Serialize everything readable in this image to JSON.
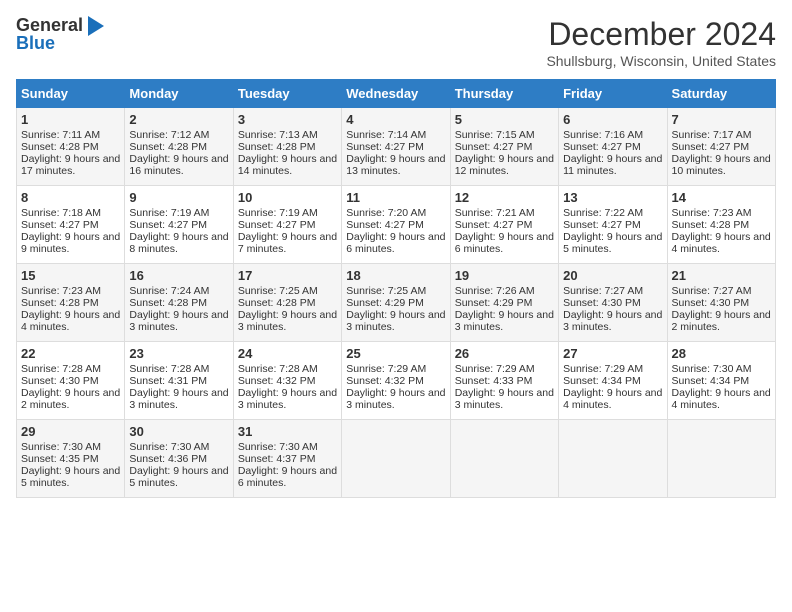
{
  "header": {
    "logo_line1": "General",
    "logo_line2": "Blue",
    "month": "December 2024",
    "location": "Shullsburg, Wisconsin, United States"
  },
  "days_of_week": [
    "Sunday",
    "Monday",
    "Tuesday",
    "Wednesday",
    "Thursday",
    "Friday",
    "Saturday"
  ],
  "weeks": [
    [
      {
        "day": "1",
        "sunrise": "7:11 AM",
        "sunset": "4:28 PM",
        "daylight": "9 hours and 17 minutes."
      },
      {
        "day": "2",
        "sunrise": "7:12 AM",
        "sunset": "4:28 PM",
        "daylight": "9 hours and 16 minutes."
      },
      {
        "day": "3",
        "sunrise": "7:13 AM",
        "sunset": "4:28 PM",
        "daylight": "9 hours and 14 minutes."
      },
      {
        "day": "4",
        "sunrise": "7:14 AM",
        "sunset": "4:27 PM",
        "daylight": "9 hours and 13 minutes."
      },
      {
        "day": "5",
        "sunrise": "7:15 AM",
        "sunset": "4:27 PM",
        "daylight": "9 hours and 12 minutes."
      },
      {
        "day": "6",
        "sunrise": "7:16 AM",
        "sunset": "4:27 PM",
        "daylight": "9 hours and 11 minutes."
      },
      {
        "day": "7",
        "sunrise": "7:17 AM",
        "sunset": "4:27 PM",
        "daylight": "9 hours and 10 minutes."
      }
    ],
    [
      {
        "day": "8",
        "sunrise": "7:18 AM",
        "sunset": "4:27 PM",
        "daylight": "9 hours and 9 minutes."
      },
      {
        "day": "9",
        "sunrise": "7:19 AM",
        "sunset": "4:27 PM",
        "daylight": "9 hours and 8 minutes."
      },
      {
        "day": "10",
        "sunrise": "7:19 AM",
        "sunset": "4:27 PM",
        "daylight": "9 hours and 7 minutes."
      },
      {
        "day": "11",
        "sunrise": "7:20 AM",
        "sunset": "4:27 PM",
        "daylight": "9 hours and 6 minutes."
      },
      {
        "day": "12",
        "sunrise": "7:21 AM",
        "sunset": "4:27 PM",
        "daylight": "9 hours and 6 minutes."
      },
      {
        "day": "13",
        "sunrise": "7:22 AM",
        "sunset": "4:27 PM",
        "daylight": "9 hours and 5 minutes."
      },
      {
        "day": "14",
        "sunrise": "7:23 AM",
        "sunset": "4:28 PM",
        "daylight": "9 hours and 4 minutes."
      }
    ],
    [
      {
        "day": "15",
        "sunrise": "7:23 AM",
        "sunset": "4:28 PM",
        "daylight": "9 hours and 4 minutes."
      },
      {
        "day": "16",
        "sunrise": "7:24 AM",
        "sunset": "4:28 PM",
        "daylight": "9 hours and 3 minutes."
      },
      {
        "day": "17",
        "sunrise": "7:25 AM",
        "sunset": "4:28 PM",
        "daylight": "9 hours and 3 minutes."
      },
      {
        "day": "18",
        "sunrise": "7:25 AM",
        "sunset": "4:29 PM",
        "daylight": "9 hours and 3 minutes."
      },
      {
        "day": "19",
        "sunrise": "7:26 AM",
        "sunset": "4:29 PM",
        "daylight": "9 hours and 3 minutes."
      },
      {
        "day": "20",
        "sunrise": "7:27 AM",
        "sunset": "4:30 PM",
        "daylight": "9 hours and 3 minutes."
      },
      {
        "day": "21",
        "sunrise": "7:27 AM",
        "sunset": "4:30 PM",
        "daylight": "9 hours and 2 minutes."
      }
    ],
    [
      {
        "day": "22",
        "sunrise": "7:28 AM",
        "sunset": "4:30 PM",
        "daylight": "9 hours and 2 minutes."
      },
      {
        "day": "23",
        "sunrise": "7:28 AM",
        "sunset": "4:31 PM",
        "daylight": "9 hours and 3 minutes."
      },
      {
        "day": "24",
        "sunrise": "7:28 AM",
        "sunset": "4:32 PM",
        "daylight": "9 hours and 3 minutes."
      },
      {
        "day": "25",
        "sunrise": "7:29 AM",
        "sunset": "4:32 PM",
        "daylight": "9 hours and 3 minutes."
      },
      {
        "day": "26",
        "sunrise": "7:29 AM",
        "sunset": "4:33 PM",
        "daylight": "9 hours and 3 minutes."
      },
      {
        "day": "27",
        "sunrise": "7:29 AM",
        "sunset": "4:34 PM",
        "daylight": "9 hours and 4 minutes."
      },
      {
        "day": "28",
        "sunrise": "7:30 AM",
        "sunset": "4:34 PM",
        "daylight": "9 hours and 4 minutes."
      }
    ],
    [
      {
        "day": "29",
        "sunrise": "7:30 AM",
        "sunset": "4:35 PM",
        "daylight": "9 hours and 5 minutes."
      },
      {
        "day": "30",
        "sunrise": "7:30 AM",
        "sunset": "4:36 PM",
        "daylight": "9 hours and 5 minutes."
      },
      {
        "day": "31",
        "sunrise": "7:30 AM",
        "sunset": "4:37 PM",
        "daylight": "9 hours and 6 minutes."
      },
      null,
      null,
      null,
      null
    ]
  ]
}
